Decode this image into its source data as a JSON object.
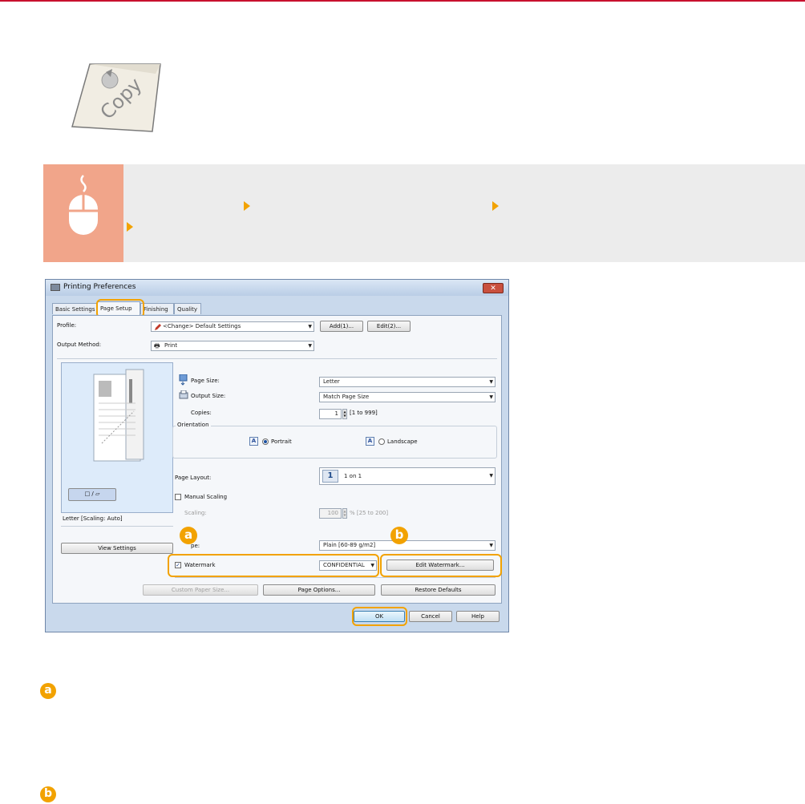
{
  "illustration": {
    "text": "Copy"
  },
  "dialog": {
    "title": "Printing Preferences",
    "close_label": "✕",
    "tabs": [
      {
        "label": "Basic Settings"
      },
      {
        "label": "Page Setup"
      },
      {
        "label": "Finishing"
      },
      {
        "label": "Quality"
      }
    ],
    "profile": {
      "label": "Profile:",
      "value": "<Change> Default Settings",
      "add_label": "Add(1)...",
      "edit_label": "Edit(2)..."
    },
    "output_method": {
      "label": "Output Method:",
      "value": "Print"
    },
    "page_size": {
      "label": "Page Size:",
      "value": "Letter"
    },
    "output_size": {
      "label": "Output Size:",
      "value": "Match Page Size"
    },
    "copies": {
      "label": "Copies:",
      "value": "1",
      "range": "[1 to 999]"
    },
    "orientation": {
      "label": "Orientation",
      "portrait": "Portrait",
      "landscape": "Landscape",
      "selected": "Portrait"
    },
    "page_layout": {
      "label": "Page Layout:",
      "icon_text": "1",
      "value": "1 on 1"
    },
    "manual_scaling": {
      "label": "Manual Scaling",
      "checked": false
    },
    "scaling": {
      "label": "Scaling:",
      "value": "100",
      "range": "% [25 to 200]"
    },
    "preview_caption": "Letter [Scaling: Auto]",
    "view_settings_label": "View Settings",
    "paper_type": {
      "label": "pe:",
      "value": "Plain [60-89 g/m2]"
    },
    "watermark": {
      "label": "Watermark",
      "checked": true,
      "value": "CONFIDENTIAL",
      "edit_label": "Edit Watermark..."
    },
    "bottom_buttons": {
      "custom_paper_size": "Custom Paper Size...",
      "page_options": "Page Options...",
      "restore_defaults": "Restore Defaults"
    },
    "footer": {
      "ok": "OK",
      "cancel": "Cancel",
      "help": "Help"
    }
  },
  "callouts": {
    "a": "a",
    "b": "b"
  },
  "colors": {
    "accent": "#f2a200",
    "topline": "#c8102e",
    "banner_bg": "#ececec",
    "mouse_icon_bg": "#f1a58a"
  }
}
